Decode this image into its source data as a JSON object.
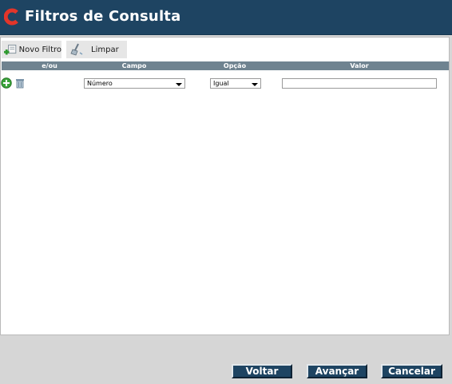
{
  "header": {
    "title": "Filtros de Consulta",
    "logo_icon": "c-logo-icon",
    "accent": "#1e4462",
    "logo_color": "#e2352a"
  },
  "toolbar": {
    "new_filter_label": "Novo Filtro",
    "new_filter_icon": "add-filter-icon",
    "clear_label": "Limpar",
    "clear_icon": "broom-icon"
  },
  "grid": {
    "columns": [
      "e/ou",
      "Campo",
      "Opção",
      "Valor"
    ],
    "rows": [
      {
        "add_icon": "plus-circle-icon",
        "delete_icon": "trash-icon",
        "campo": "Número",
        "opcao": "Igual",
        "valor": ""
      }
    ]
  },
  "footer": {
    "back_label": "Voltar",
    "next_label": "Avançar",
    "cancel_label": "Cancelar"
  }
}
